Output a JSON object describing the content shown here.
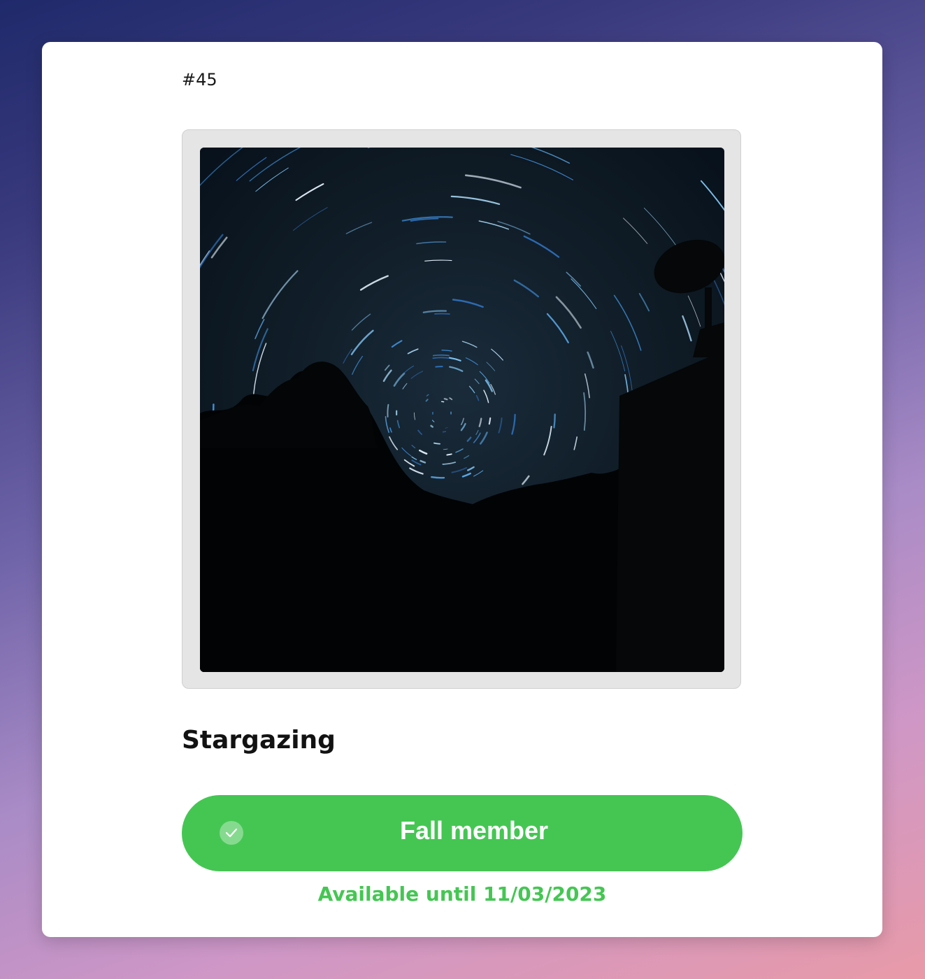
{
  "card": {
    "number": "#45",
    "title": "Stargazing",
    "button_label": "Fall member",
    "availability": "Available until 11/03/2023"
  },
  "icons": {
    "check": "check-icon"
  },
  "colors": {
    "accent": "#45c653",
    "card_bg": "#ffffff",
    "frame_bg": "#e5e5e5"
  }
}
